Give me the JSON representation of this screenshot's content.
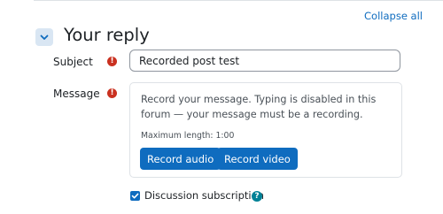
{
  "header": {
    "collapse_all": "Collapse all",
    "section_title": "Your reply"
  },
  "form": {
    "subject": {
      "label": "Subject",
      "value": "Recorded post test",
      "required_icon": "!"
    },
    "message": {
      "label": "Message",
      "required_icon": "!",
      "recorder_instructions": "Record your message. Typing is disabled in this forum — your message must be a recording.",
      "max_length": "Maximum length: 1:00",
      "record_audio_label": "Record audio",
      "record_video_label": "Record video"
    },
    "discussion_subscription": {
      "label": "Discussion subscription",
      "checked": true,
      "help_icon": "?"
    }
  },
  "icons": {
    "section_toggle": "chevron-down-icon",
    "required": "exclamation-circle-icon",
    "help": "question-circle-icon",
    "checkbox": "check-icon"
  },
  "colors": {
    "primary": "#0f6cbf",
    "required": "#ca3120",
    "help": "#008196",
    "toggle_bg": "#d9e6f3"
  }
}
